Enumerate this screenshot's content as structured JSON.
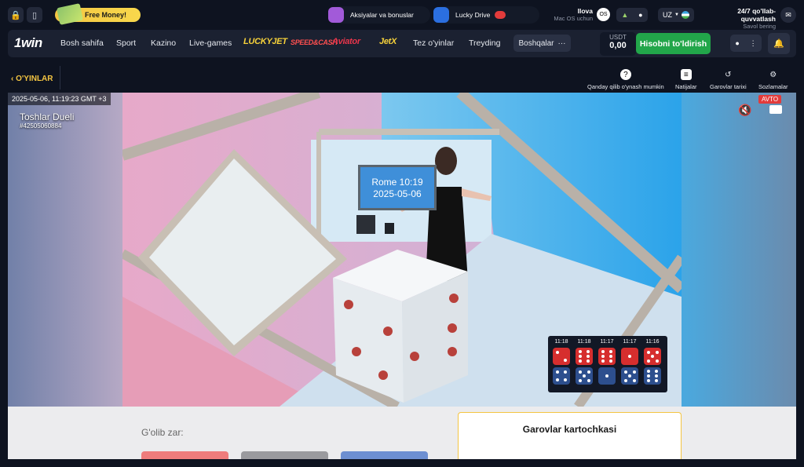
{
  "top": {
    "promo_label": "Free Money!",
    "bonus_label": "Aksiyalar va bonuslar",
    "lucky_drive_label": "Lucky Drive",
    "app_title": "Ilova",
    "app_sub": "Mac OS uchun",
    "lang": "UZ",
    "support_title": "24/7 qo'llab-quvvatlash",
    "support_sub": "Savol bering"
  },
  "nav": {
    "logo": "1win",
    "items": [
      "Bosh sahifa",
      "Sport",
      "Kazino",
      "Live-games"
    ],
    "brands": [
      "LUCKYJET",
      "SPEED&CASH",
      "Aviator",
      "JetX"
    ],
    "items2": [
      "Tez o'yinlar",
      "Treyding"
    ],
    "more_label": "Boshqalar",
    "currency": "USDT",
    "balance": "0,00",
    "deposit_label": "Hisobni to'ldirish"
  },
  "gamebar": {
    "back_label": "O'YINLAR",
    "tools": [
      "Qanday qilib o'ynash mumkin",
      "Natijalar",
      "Garovlar tarixi",
      "Sozlamalar"
    ]
  },
  "stream": {
    "timestamp": "2025-05-06, 11:19:23 GMT +3",
    "game_title": "Toshlar Dueli",
    "game_id": "#42505060884",
    "auto_label": "AVTO",
    "screen_line1": "Rome 10:19",
    "screen_line2": "2025-05-06",
    "history": [
      {
        "time": "11:18",
        "red": 2,
        "blue": 4
      },
      {
        "time": "11:18",
        "red": 6,
        "blue": 5
      },
      {
        "time": "11:17",
        "red": 6,
        "blue": 1
      },
      {
        "time": "11:17",
        "red": 1,
        "blue": 5
      },
      {
        "time": "11:16",
        "red": 5,
        "blue": 6
      }
    ]
  },
  "bottom": {
    "winner_label": "G'olib zar:",
    "bet_card_title": "Garovlar kartochkasi"
  },
  "colors": {
    "accent_green": "#22a64a",
    "accent_yellow": "#f4c542",
    "red_die": "#d62e2e",
    "blue_die": "#2d4f8e"
  }
}
